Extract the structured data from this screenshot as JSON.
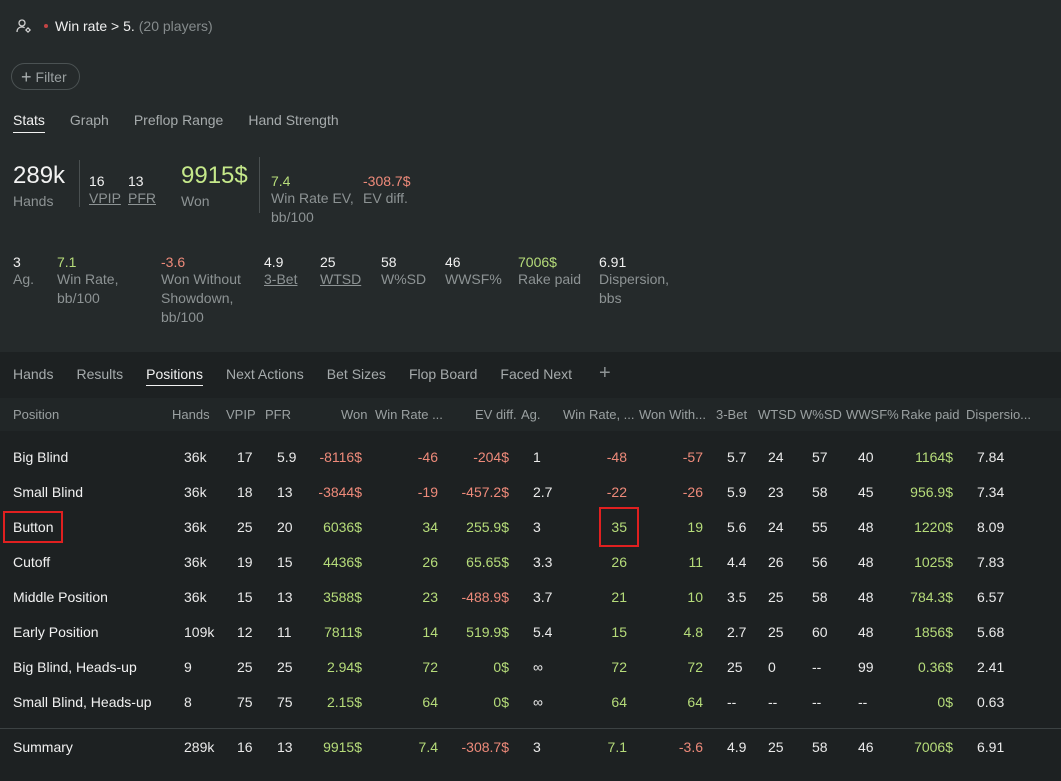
{
  "breadcrumb": {
    "title": "Win rate > 5.",
    "count": "(20 players)"
  },
  "filter": {
    "label": "Filter"
  },
  "stat_tabs": [
    "Stats",
    "Graph",
    "Preflop Range",
    "Hand Strength"
  ],
  "summary_stats": {
    "hands": {
      "value": "289k",
      "label": "Hands"
    },
    "vpip": {
      "value": "16",
      "label": "VPIP"
    },
    "pfr": {
      "value": "13",
      "label": "PFR"
    },
    "won": {
      "value": "9915$",
      "label": "Won"
    },
    "winrate_ev": {
      "value": "7.4",
      "label1": "Win Rate EV,",
      "label2": "bb/100"
    },
    "ev_diff": {
      "value": "-308.7$",
      "label": "EV diff."
    },
    "ag": {
      "value": "3",
      "label": "Ag."
    },
    "winrate": {
      "value": "7.1",
      "label1": "Win Rate,",
      "label2": "bb/100"
    },
    "won_wo_sd": {
      "value": "-3.6",
      "label1": "Won Without",
      "label2": "Showdown,",
      "label3": "bb/100"
    },
    "threebet": {
      "value": "4.9",
      "label": "3-Bet"
    },
    "wtsd": {
      "value": "25",
      "label": "WTSD"
    },
    "wsd": {
      "value": "58",
      "label": "W%SD"
    },
    "wwsf": {
      "value": "46",
      "label": "WWSF%"
    },
    "rake": {
      "value": "7006$",
      "label": "Rake paid"
    },
    "dispersion": {
      "value": "6.91",
      "label1": "Dispersion,",
      "label2": "bbs"
    }
  },
  "report_tabs": [
    "Hands",
    "Results",
    "Positions",
    "Next Actions",
    "Bet Sizes",
    "Flop Board",
    "Faced Next"
  ],
  "table": {
    "columns": [
      "Position",
      "Hands",
      "VPIP",
      "PFR",
      "Won",
      "Win Rate ...",
      "EV diff.",
      "Ag.",
      "Win Rate, ...",
      "Won With...",
      "3-Bet",
      "WTSD",
      "W%SD",
      "WWSF%",
      "Rake paid",
      "Dispersio..."
    ],
    "rows": [
      [
        "Big Blind",
        "36k",
        "17",
        "5.9",
        "-8116$",
        "-46",
        "-204$",
        "1",
        "-48",
        "-57",
        "5.7",
        "24",
        "57",
        "40",
        "1164$",
        "7.84"
      ],
      [
        "Small Blind",
        "36k",
        "18",
        "13",
        "-3844$",
        "-19",
        "-457.2$",
        "2.7",
        "-22",
        "-26",
        "5.9",
        "23",
        "58",
        "45",
        "956.9$",
        "7.34"
      ],
      [
        "Button",
        "36k",
        "25",
        "20",
        "6036$",
        "34",
        "255.9$",
        "3",
        "35",
        "19",
        "5.6",
        "24",
        "55",
        "48",
        "1220$",
        "8.09"
      ],
      [
        "Cutoff",
        "36k",
        "19",
        "15",
        "4436$",
        "26",
        "65.65$",
        "3.3",
        "26",
        "11",
        "4.4",
        "26",
        "56",
        "48",
        "1025$",
        "7.83"
      ],
      [
        "Middle Position",
        "36k",
        "15",
        "13",
        "3588$",
        "23",
        "-488.9$",
        "3.7",
        "21",
        "10",
        "3.5",
        "25",
        "58",
        "48",
        "784.3$",
        "6.57"
      ],
      [
        "Early Position",
        "109k",
        "12",
        "11",
        "7811$",
        "14",
        "519.9$",
        "5.4",
        "15",
        "4.8",
        "2.7",
        "25",
        "60",
        "48",
        "1856$",
        "5.68"
      ],
      [
        "Big Blind, Heads-up",
        "9",
        "25",
        "25",
        "2.94$",
        "72",
        "0$",
        "∞",
        "72",
        "72",
        "25",
        "0",
        "--",
        "99",
        "0.36$",
        "2.41"
      ],
      [
        "Small Blind, Heads-up",
        "8",
        "75",
        "75",
        "2.15$",
        "64",
        "0$",
        "∞",
        "64",
        "64",
        "--",
        "--",
        "--",
        "--",
        "0$",
        "0.63"
      ]
    ],
    "summary": [
      "Summary",
      "289k",
      "16",
      "13",
      "9915$",
      "7.4",
      "-308.7$",
      "3",
      "7.1",
      "-3.6",
      "4.9",
      "25",
      "58",
      "46",
      "7006$",
      "6.91"
    ]
  },
  "colors": {
    "positive": "#b6dc7a",
    "negative": "#ee8a7a",
    "highlight": "#e02020"
  }
}
